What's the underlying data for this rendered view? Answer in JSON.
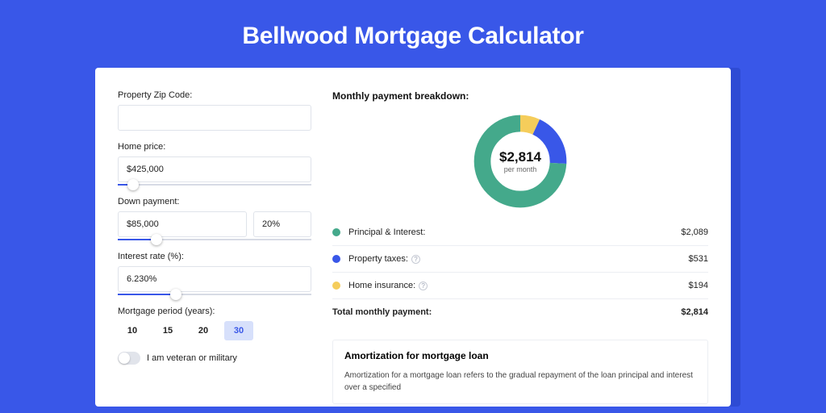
{
  "hero": {
    "title": "Bellwood Mortgage Calculator"
  },
  "form": {
    "zip": {
      "label": "Property Zip Code:",
      "value": ""
    },
    "home_price": {
      "label": "Home price:",
      "value": "$425,000",
      "slider_pct": 8
    },
    "down_payment": {
      "label": "Down payment:",
      "value": "$85,000",
      "pct_value": "20%",
      "slider_pct": 20
    },
    "interest": {
      "label": "Interest rate (%):",
      "value": "6.230%",
      "slider_pct": 30
    },
    "period": {
      "label": "Mortgage period (years):",
      "options": [
        "10",
        "15",
        "20",
        "30"
      ],
      "active": "30"
    },
    "veteran": {
      "label": "I am veteran or military",
      "on": false
    }
  },
  "breakdown": {
    "title": "Monthly payment breakdown:",
    "center_amount": "$2,814",
    "center_sub": "per month",
    "items": [
      {
        "label": "Principal & Interest:",
        "value": "$2,089",
        "color": "#44a98b",
        "info": false
      },
      {
        "label": "Property taxes:",
        "value": "$531",
        "color": "#3957e8",
        "info": true
      },
      {
        "label": "Home insurance:",
        "value": "$194",
        "color": "#f5cd5b",
        "info": true
      }
    ],
    "total_label": "Total monthly payment:",
    "total_value": "$2,814"
  },
  "chart_data": {
    "type": "pie",
    "title": "Monthly payment breakdown",
    "series": [
      {
        "name": "Principal & Interest",
        "value": 2089,
        "color": "#44a98b"
      },
      {
        "name": "Property taxes",
        "value": 531,
        "color": "#3957e8"
      },
      {
        "name": "Home insurance",
        "value": 194,
        "color": "#f5cd5b"
      }
    ],
    "total": 2814,
    "center_label": "$2,814 per month"
  },
  "amortization": {
    "title": "Amortization for mortgage loan",
    "text": "Amortization for a mortgage loan refers to the gradual repayment of the loan principal and interest over a specified"
  }
}
